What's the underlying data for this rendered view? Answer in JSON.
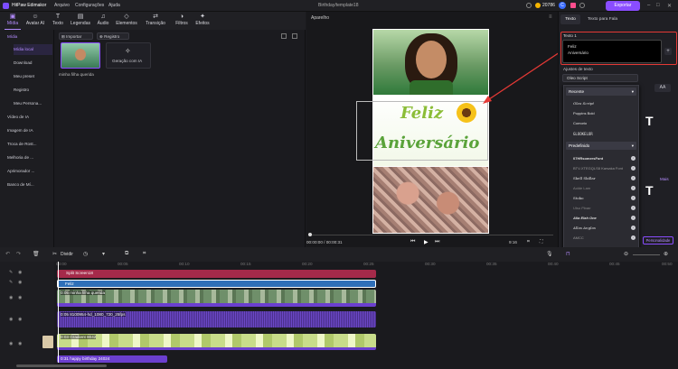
{
  "app": {
    "name": "HitPaw Edimakor",
    "menu": [
      "Arquivo",
      "Configurações",
      "Ajuda"
    ],
    "project": "Birthday/template18",
    "credits": "20786",
    "export_label": "Exportar"
  },
  "toolbar": [
    {
      "label": "Mídia",
      "icon": "media-icon"
    },
    {
      "label": "Avatar AI",
      "icon": "avatar-icon"
    },
    {
      "label": "Texto",
      "icon": "text-icon"
    },
    {
      "label": "Legendas",
      "icon": "subtitles-icon"
    },
    {
      "label": "Áudio",
      "icon": "audio-icon"
    },
    {
      "label": "Elementos",
      "icon": "elements-icon"
    },
    {
      "label": "Transição",
      "icon": "transition-icon"
    },
    {
      "label": "Filtros",
      "icon": "filters-icon"
    },
    {
      "label": "Efeitos",
      "icon": "effects-icon"
    }
  ],
  "leftnav": {
    "items": [
      "Mídia",
      "Mídia local",
      "Download",
      "Meu preset",
      "Registro",
      "Meu Persona...",
      "Vídeo de IA",
      "Imagem de IA",
      "Troca de Rost...",
      "Melhoria de ...",
      "Aprimorador ...",
      "Banco de Mí..."
    ]
  },
  "media": {
    "import_label": "Importar",
    "record_label": "Registro",
    "thumb_caption": "minha filha querida",
    "ai_label": "Geração com IA"
  },
  "preview": {
    "label": "Aparelho",
    "title_line1": "Feliz",
    "title_line2": "Aniversário",
    "time": "00:00:00 / 00:00:31",
    "ratio": "9:16"
  },
  "rpanel": {
    "tabs": [
      "Texto",
      "Texto para Fala"
    ],
    "section_label": "Texto 1",
    "text_value": "Feliz\nAniversário",
    "settings_label": "Ajustes de texto",
    "font_value": "Oleo Script",
    "aa_label": "AA",
    "more_label": "Mais",
    "custom_label": "Personalidade"
  },
  "fontdd": {
    "recent_label": "Recente",
    "recent": [
      "Oleo Script",
      "Poppins Bold",
      "Comorio",
      "GLOOKELOR"
    ],
    "preset_label": "Predefinido",
    "preset": [
      "07HRsomersFont",
      "BTV-XTEGQLS8 Karsaka Font",
      "Skell Skillar",
      "Aolde Lam",
      "Stoko",
      "Ulsu Ploan",
      "Alla Elah One",
      "Allas Anglas",
      "AMCC"
    ]
  },
  "timeline": {
    "divide_label": "Dividir",
    "ruler": [
      "00:00",
      "00:05",
      "00:10",
      "00:15",
      "00:20",
      "00:25",
      "00:30",
      "00:35",
      "00:40",
      "00:45",
      "00:50",
      "00:55"
    ],
    "clip_split": "Split Screen18",
    "clip_text": "Feliz",
    "clip_video": "0:05 minha filha querida",
    "clip_video2": "0:05 8100954-hd_1080_720_25fps",
    "clip_bg": "0:03 Gradient 8042",
    "clip_audio": "0:31 happy birthday 24024"
  }
}
